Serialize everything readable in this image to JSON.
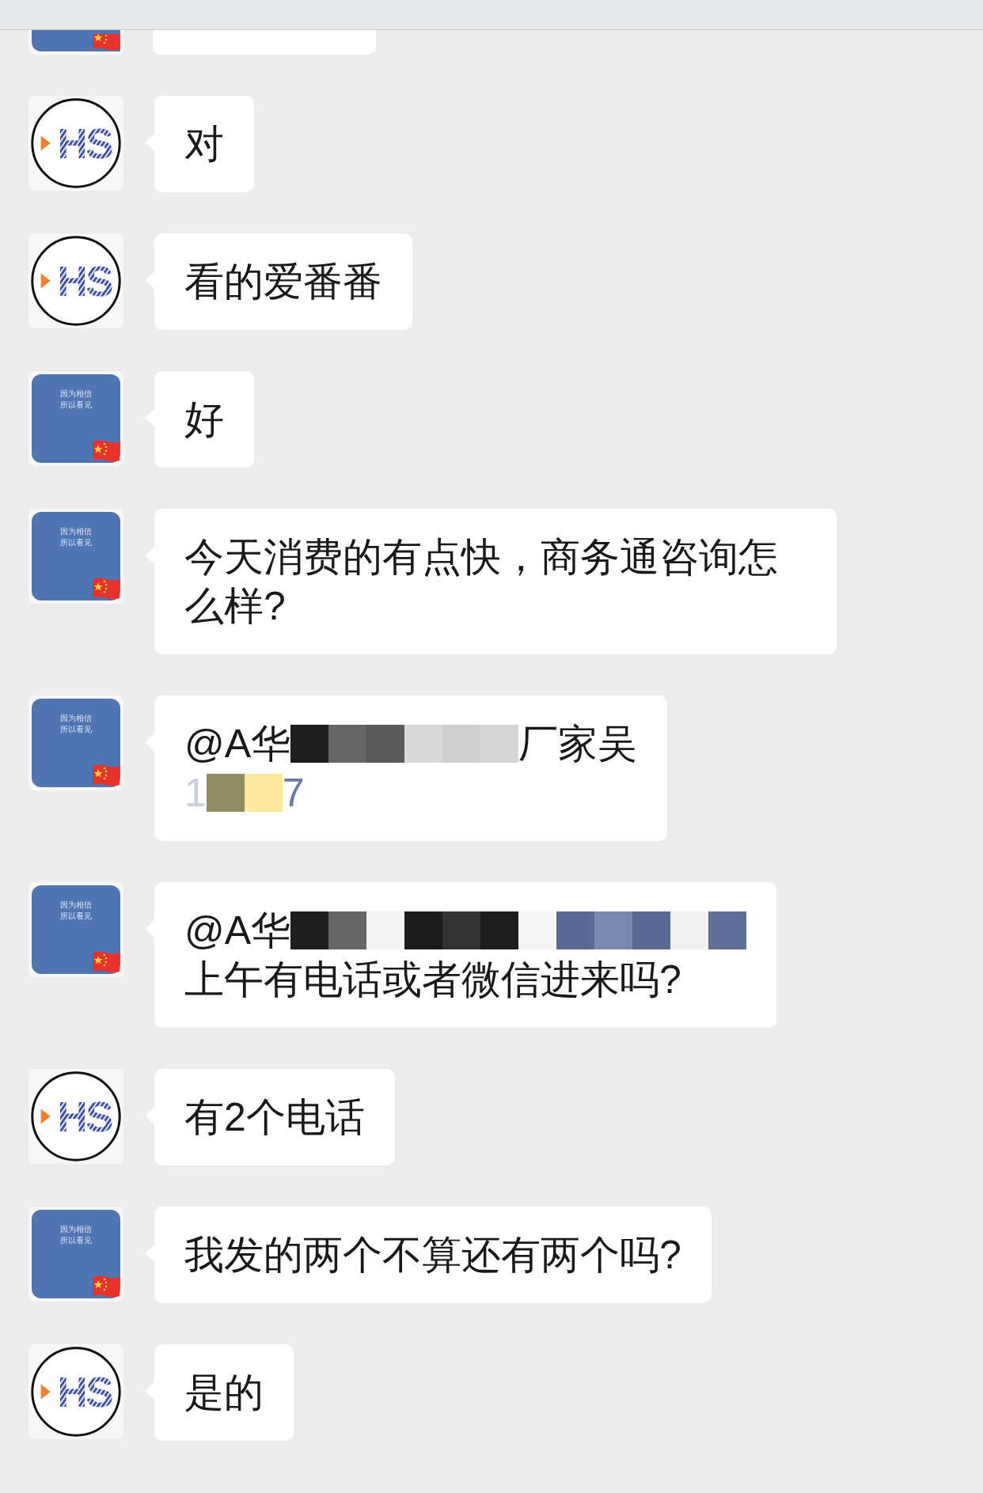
{
  "messages": [
    {
      "cut": true,
      "avatar": {
        "kind": "card",
        "flag": true
      }
    },
    {
      "avatar": {
        "kind": "logo",
        "text": "HS"
      },
      "text": "对"
    },
    {
      "avatar": {
        "kind": "logo",
        "text": "HS"
      },
      "text": "看的爱番番"
    },
    {
      "avatar": {
        "kind": "card",
        "lines": [
          "因为相信",
          "所以看见"
        ],
        "flag": true
      },
      "text": "好"
    },
    {
      "avatar": {
        "kind": "card",
        "lines": [
          "因为相信",
          "所以看见"
        ],
        "flag": true
      },
      "text": "今天消费的有点快，商务通咨询怎么样?"
    },
    {
      "avatar": {
        "kind": "card",
        "lines": [
          "因为相信",
          "所以看见"
        ],
        "flag": true
      },
      "lines": [
        [
          {
            "kind": "text",
            "text": "@A华"
          },
          {
            "kind": "mosaic",
            "cells": [
              {
                "color": "#1e1e1e"
              },
              {
                "color": "#666666"
              },
              {
                "color": "#5a5a5a"
              },
              {
                "color": "#d8d8d8"
              },
              {
                "color": "#cfcfcf"
              },
              {
                "color": "#d6d6d6"
              }
            ]
          },
          {
            "kind": "text",
            "text": "厂家吴"
          }
        ],
        [
          {
            "kind": "text",
            "text": "1",
            "color": "#c9cfdc"
          },
          {
            "kind": "mosaic",
            "cells": [
              {
                "color": "#908d62"
              },
              {
                "color": "#fde89c"
              }
            ]
          },
          {
            "kind": "text",
            "text": "7",
            "color": "#6b7aa0"
          }
        ]
      ]
    },
    {
      "avatar": {
        "kind": "card",
        "lines": [
          "因为相信",
          "所以看见"
        ],
        "flag": true
      },
      "lines": [
        [
          {
            "kind": "text",
            "text": "@A华"
          },
          {
            "kind": "mosaic",
            "cells": [
              {
                "color": "#1e1e1e"
              },
              {
                "color": "#666666"
              },
              {
                "color": "#f2f2f2"
              },
              {
                "color": "#1c1c1c"
              },
              {
                "color": "#333333"
              },
              {
                "color": "#1e1e1e"
              },
              {
                "color": "#f4f4f4"
              },
              {
                "color": "#5a6a96"
              },
              {
                "color": "#7888b0"
              },
              {
                "color": "#5a6a96"
              },
              {
                "color": "#f0f0f0"
              },
              {
                "color": "#5f6f9a"
              }
            ]
          }
        ],
        [
          {
            "kind": "text",
            "text": "上午有电话或者微信进来吗?"
          }
        ]
      ]
    },
    {
      "avatar": {
        "kind": "logo",
        "text": "HS"
      },
      "text": "有2个电话"
    },
    {
      "avatar": {
        "kind": "card",
        "lines": [
          "因为相信",
          "所以看见"
        ],
        "flag": true
      },
      "text": "我发的两个不算还有两个吗?"
    },
    {
      "avatar": {
        "kind": "logo",
        "text": "HS"
      },
      "text": "是的"
    }
  ]
}
